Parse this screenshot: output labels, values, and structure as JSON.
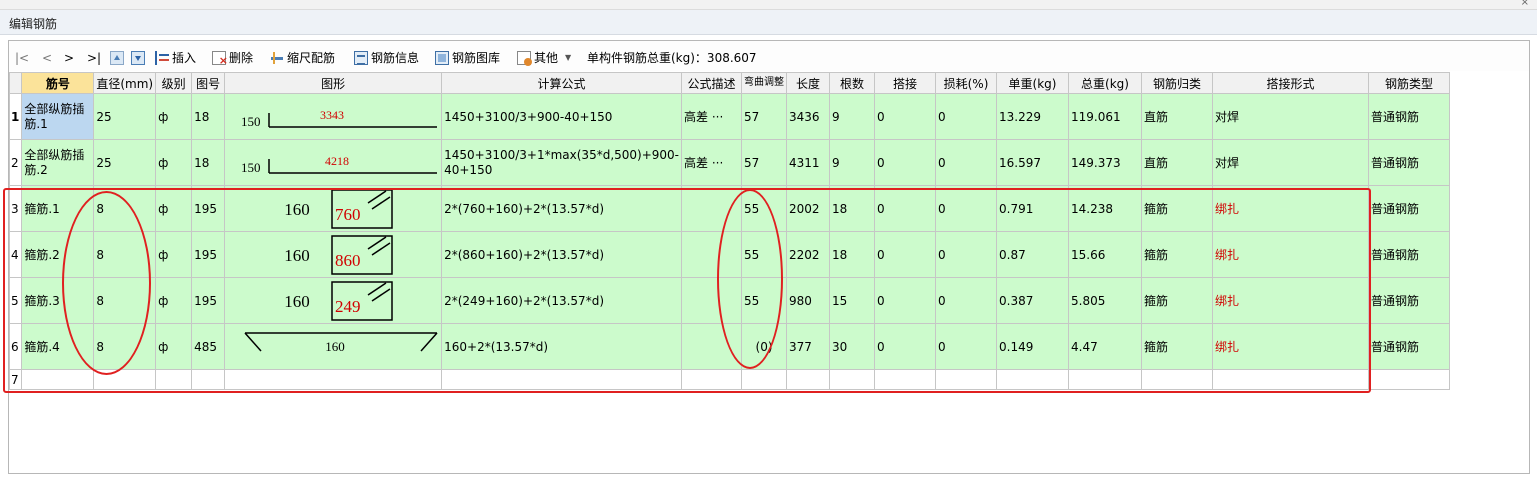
{
  "window": {
    "title": "编辑钢筋",
    "close_glyph": "×"
  },
  "toolbar": {
    "first": "|<",
    "prev": "<",
    "next": ">",
    "last": ">|",
    "insert": "插入",
    "delete": "删除",
    "scale": "缩尺配筋",
    "info": "钢筋信息",
    "library": "钢筋图库",
    "other": "其他",
    "total_weight": "单构件钢筋总重(kg)：308.607"
  },
  "columns": [
    "筋号",
    "直径(mm)",
    "级别",
    "图号",
    "图形",
    "计算公式",
    "公式描述",
    "弯曲调整",
    "长度",
    "根数",
    "搭接",
    "损耗(%)",
    "单重(kg)",
    "总重(kg)",
    "钢筋归类",
    "搭接形式",
    "钢筋类型"
  ],
  "rows": [
    {
      "num": "1",
      "name": "全部纵筋插筋.1",
      "dia": "25",
      "grade": "ф",
      "fig": "18",
      "shape_a": "150",
      "shape_b": "3343",
      "formula": "1450+3100/3+900-40+150",
      "desc": "高差 ···",
      "bend": "57",
      "len": "3436",
      "count": "9",
      "lap": "0",
      "loss": "0",
      "unit": "13.229",
      "total": "119.061",
      "cat": "直筋",
      "lapform": "对焊",
      "type": "普通钢筋"
    },
    {
      "num": "2",
      "name": "全部纵筋插筋.2",
      "dia": "25",
      "grade": "ф",
      "fig": "18",
      "shape_a": "150",
      "shape_b": "4218",
      "formula": "1450+3100/3+1*max(35*d,500)+900-40+150",
      "desc": "高差 ···",
      "bend": "57",
      "len": "4311",
      "count": "9",
      "lap": "0",
      "loss": "0",
      "unit": "16.597",
      "total": "149.373",
      "cat": "直筋",
      "lapform": "对焊",
      "type": "普通钢筋"
    },
    {
      "num": "3",
      "name": "箍筋.1",
      "dia": "8",
      "grade": "ф",
      "fig": "195",
      "shape_a": "160",
      "shape_b": "760",
      "formula": "2*(760+160)+2*(13.57*d)",
      "desc": "",
      "bend": "55",
      "len": "2002",
      "count": "18",
      "lap": "0",
      "loss": "0",
      "unit": "0.791",
      "total": "14.238",
      "cat": "箍筋",
      "lapform": "绑扎",
      "type": "普通钢筋"
    },
    {
      "num": "4",
      "name": "箍筋.2",
      "dia": "8",
      "grade": "ф",
      "fig": "195",
      "shape_a": "160",
      "shape_b": "860",
      "formula": "2*(860+160)+2*(13.57*d)",
      "desc": "",
      "bend": "55",
      "len": "2202",
      "count": "18",
      "lap": "0",
      "loss": "0",
      "unit": "0.87",
      "total": "15.66",
      "cat": "箍筋",
      "lapform": "绑扎",
      "type": "普通钢筋"
    },
    {
      "num": "5",
      "name": "箍筋.3",
      "dia": "8",
      "grade": "ф",
      "fig": "195",
      "shape_a": "160",
      "shape_b": "249",
      "formula": "2*(249+160)+2*(13.57*d)",
      "desc": "",
      "bend": "55",
      "len": "980",
      "count": "15",
      "lap": "0",
      "loss": "0",
      "unit": "0.387",
      "total": "5.805",
      "cat": "箍筋",
      "lapform": "绑扎",
      "type": "普通钢筋"
    },
    {
      "num": "6",
      "name": "箍筋.4",
      "dia": "8",
      "grade": "ф",
      "fig": "485",
      "shape_a": "160",
      "shape_b": "",
      "formula": "160+2*(13.57*d)",
      "desc": "",
      "bend": "(0)",
      "len": "377",
      "count": "30",
      "lap": "0",
      "loss": "0",
      "unit": "0.149",
      "total": "4.47",
      "cat": "箍筋",
      "lapform": "绑扎",
      "type": "普通钢筋"
    }
  ],
  "empty_row_num": "7",
  "colors": {
    "row_bg": "#ccfbcc",
    "selected_cell": "#bcd7f0",
    "header_highlight": "#fbe39a",
    "annotation_red": "#e02020"
  }
}
